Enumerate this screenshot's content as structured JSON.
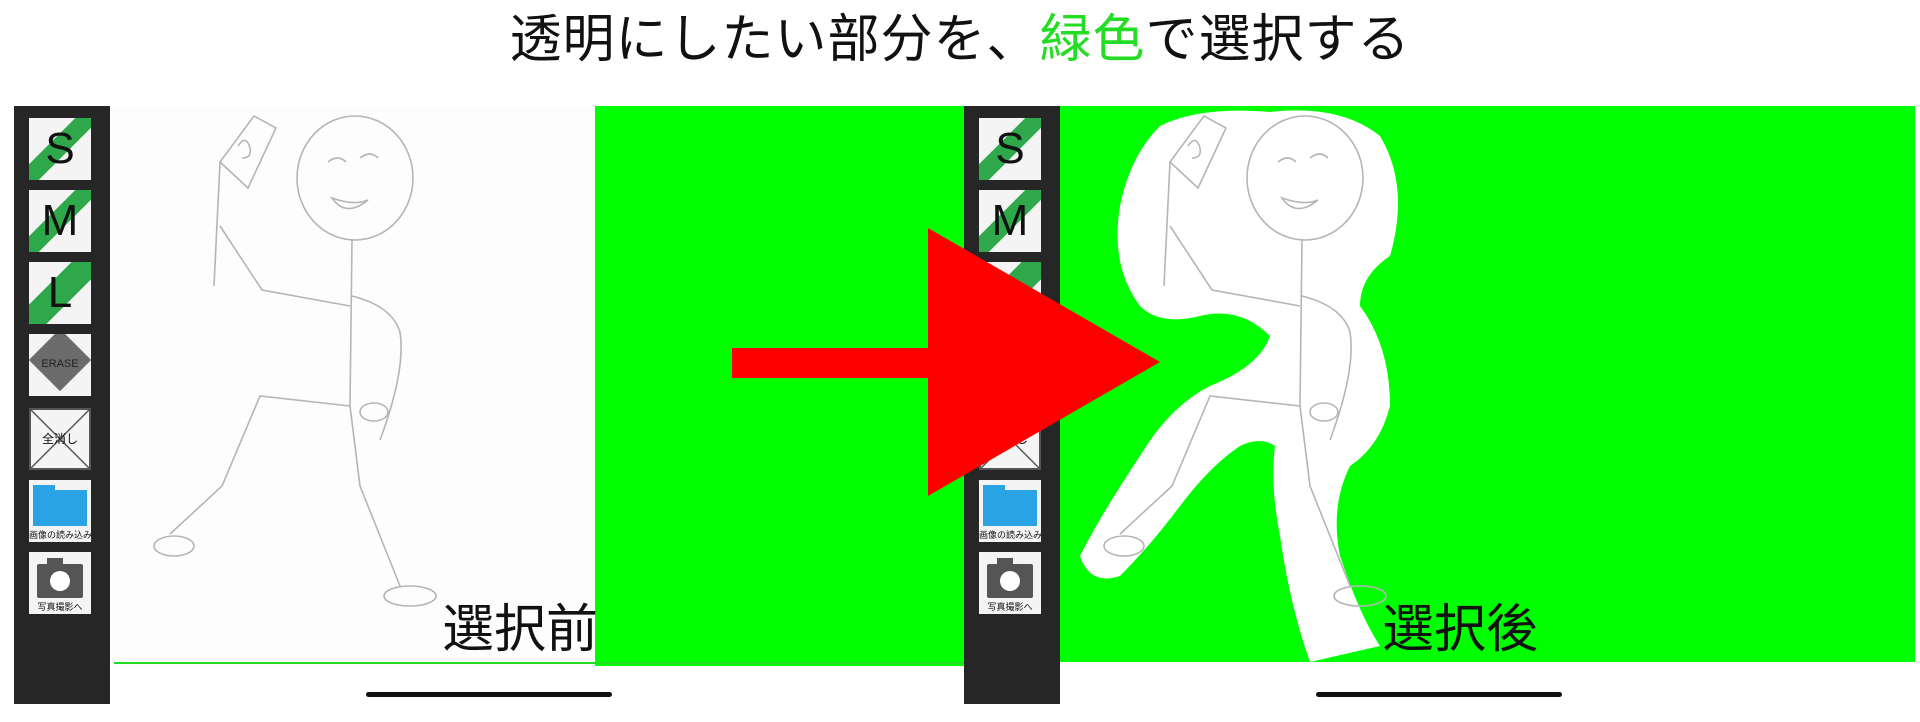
{
  "title": {
    "before": "透明にしたい部分を、",
    "highlight": "緑色",
    "after": "で選択する"
  },
  "toolbar": {
    "small": "S",
    "medium": "M",
    "large": "L",
    "erase": "ERASE",
    "clear_all": "全消し",
    "load_image": "画像の読み込み",
    "take_photo": "写真撮影へ"
  },
  "panels": {
    "before_label": "選択前",
    "after_label": "選択後"
  },
  "colors": {
    "selection_green": "#00ff00",
    "arrow_red": "#ff0000",
    "title_highlight": "#22dd22"
  },
  "icons": [
    "pencil-icon",
    "eraser-icon",
    "clear-icon",
    "folder-icon",
    "camera-icon",
    "arrow-right-icon"
  ]
}
